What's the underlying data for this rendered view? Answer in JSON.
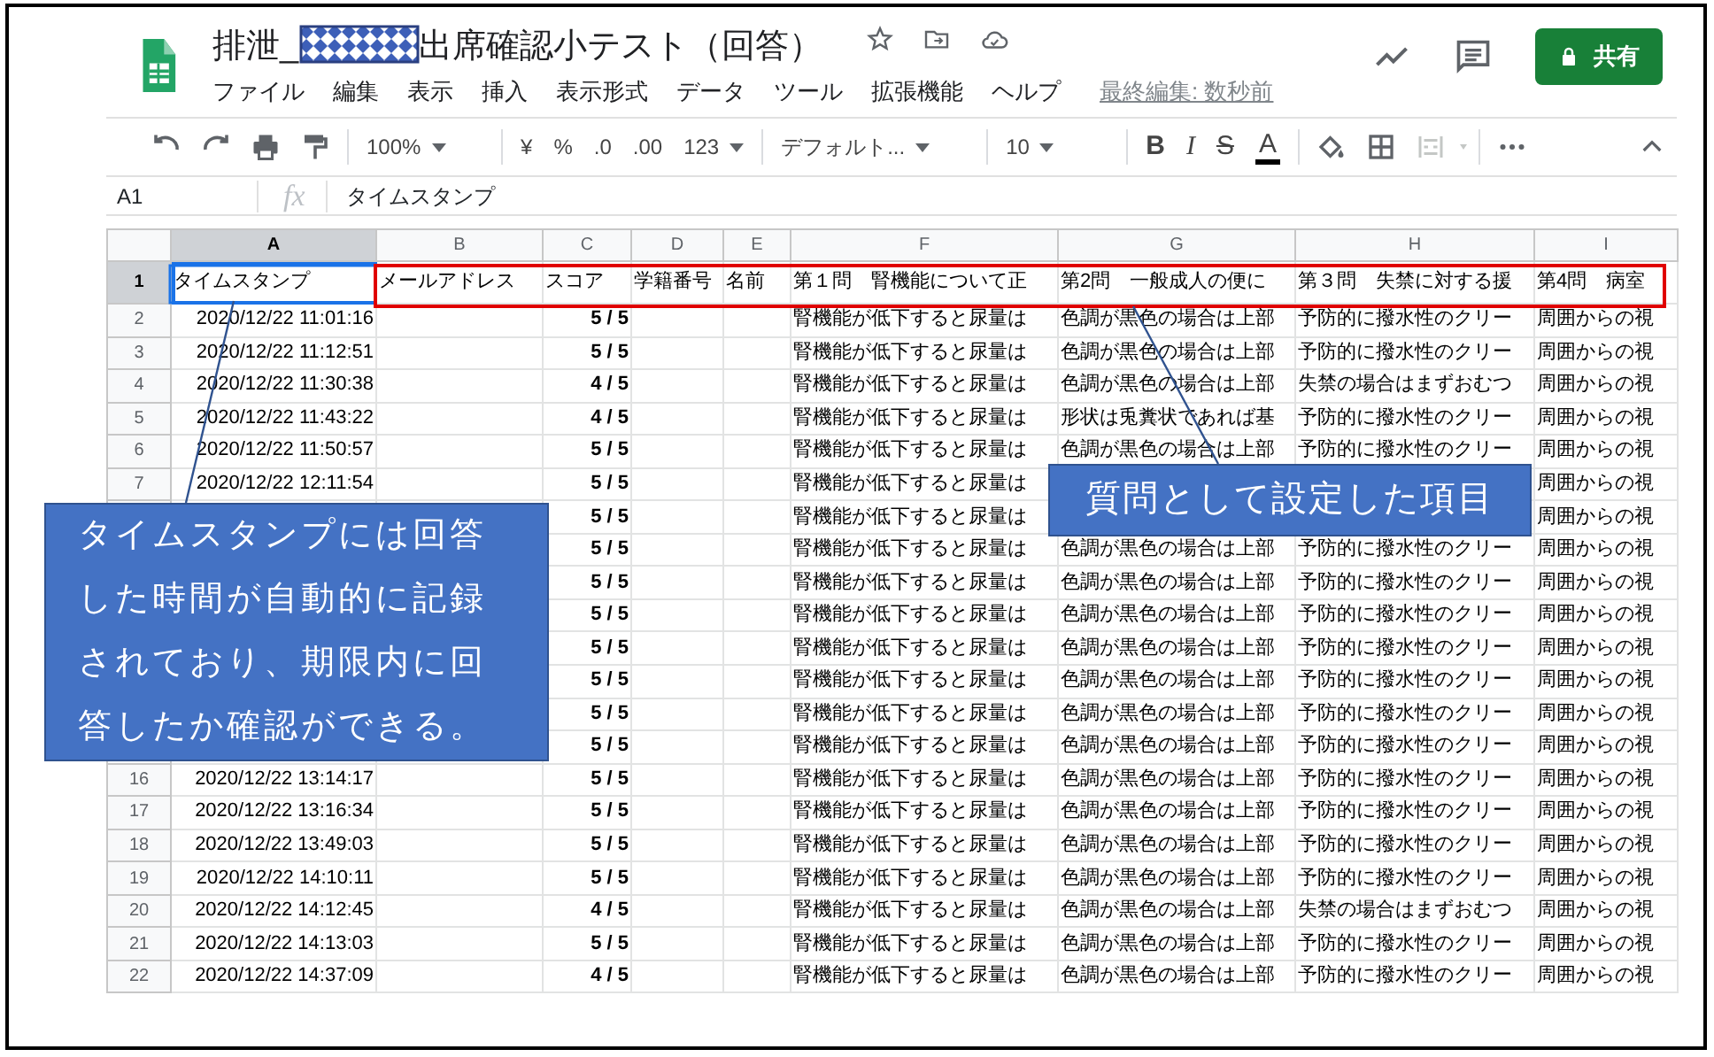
{
  "header": {
    "title_start": "排泄_",
    "title_end": "出席確認小テスト（回答）",
    "menus": [
      "ファイル",
      "編集",
      "表示",
      "挿入",
      "表示形式",
      "データ",
      "ツール",
      "拡張機能",
      "ヘルプ"
    ],
    "last_edit": "最終編集: 数秒前",
    "share": "共有"
  },
  "toolbar": {
    "zoom": "100%",
    "currency": "¥",
    "percent": "%",
    "dec_less": ".0",
    "dec_more": ".00",
    "format": "123",
    "font": "デフォルト...",
    "size": "10",
    "bold": "B",
    "italic": "I",
    "strike": "S",
    "text_color_label": "A"
  },
  "formula_bar": {
    "cell_ref": "A1",
    "fx": "fx",
    "value": "タイムスタンプ"
  },
  "columns": [
    {
      "letter": "A",
      "selected": true
    },
    {
      "letter": "B",
      "selected": false
    },
    {
      "letter": "C",
      "selected": false
    },
    {
      "letter": "D",
      "selected": false
    },
    {
      "letter": "E",
      "selected": false
    },
    {
      "letter": "F",
      "selected": false
    },
    {
      "letter": "G",
      "selected": false
    },
    {
      "letter": "H",
      "selected": false
    },
    {
      "letter": "I",
      "selected": false
    }
  ],
  "rows": [
    {
      "number": "1",
      "selected": true,
      "cells": [
        "タイムスタンプ",
        "メールアドレス",
        "スコア",
        "学籍番号",
        "名前",
        "第１問　腎機能について正",
        "第2問　一般成人の便に",
        "第３問　失禁に対する援",
        "第4問　病室"
      ]
    },
    {
      "number": "2",
      "selected": false,
      "cells": [
        "2020/12/22 11:01:16",
        "",
        "5 / 5",
        "",
        "",
        "腎機能が低下すると尿量は",
        "色調が黒色の場合は上部",
        "予防的に撥水性のクリー",
        "周囲からの視"
      ]
    },
    {
      "number": "3",
      "selected": false,
      "cells": [
        "2020/12/22 11:12:51",
        "",
        "5 / 5",
        "",
        "",
        "腎機能が低下すると尿量は",
        "色調が黒色の場合は上部",
        "予防的に撥水性のクリー",
        "周囲からの視"
      ]
    },
    {
      "number": "4",
      "selected": false,
      "cells": [
        "2020/12/22 11:30:38",
        "",
        "4 / 5",
        "",
        "",
        "腎機能が低下すると尿量は",
        "色調が黒色の場合は上部",
        "失禁の場合はまずおむつ",
        "周囲からの視"
      ]
    },
    {
      "number": "5",
      "selected": false,
      "cells": [
        "2020/12/22 11:43:22",
        "",
        "4 / 5",
        "",
        "",
        "腎機能が低下すると尿量は",
        "形状は兎糞状であれば基",
        "予防的に撥水性のクリー",
        "周囲からの視"
      ]
    },
    {
      "number": "6",
      "selected": false,
      "cells": [
        "2020/12/22 11:50:57",
        "",
        "5 / 5",
        "",
        "",
        "腎機能が低下すると尿量は",
        "色調が黒色の場合は上部",
        "予防的に撥水性のクリー",
        "周囲からの視"
      ]
    },
    {
      "number": "7",
      "selected": false,
      "cells": [
        "2020/12/22 12:11:54",
        "",
        "5 / 5",
        "",
        "",
        "腎機能が低下すると尿量は",
        "",
        "",
        "周囲からの視"
      ]
    },
    {
      "number": "",
      "selected": false,
      "cells": [
        "",
        "",
        "5 / 5",
        "",
        "",
        "腎機能が低下すると尿量は",
        "",
        "",
        "周囲からの視"
      ]
    },
    {
      "number": "",
      "selected": false,
      "cells": [
        "",
        "",
        "5 / 5",
        "",
        "",
        "腎機能が低下すると尿量は",
        "色調が黒色の場合は上部",
        "予防的に撥水性のクリー",
        "周囲からの視"
      ]
    },
    {
      "number": "",
      "selected": false,
      "cells": [
        "",
        "",
        "5 / 5",
        "",
        "",
        "腎機能が低下すると尿量は",
        "色調が黒色の場合は上部",
        "予防的に撥水性のクリー",
        "周囲からの視"
      ]
    },
    {
      "number": "",
      "selected": false,
      "cells": [
        "",
        "",
        "5 / 5",
        "",
        "",
        "腎機能が低下すると尿量は",
        "色調が黒色の場合は上部",
        "予防的に撥水性のクリー",
        "周囲からの視"
      ]
    },
    {
      "number": "",
      "selected": false,
      "cells": [
        "",
        "",
        "5 / 5",
        "",
        "",
        "腎機能が低下すると尿量は",
        "色調が黒色の場合は上部",
        "予防的に撥水性のクリー",
        "周囲からの視"
      ]
    },
    {
      "number": "",
      "selected": false,
      "cells": [
        "",
        "",
        "5 / 5",
        "",
        "",
        "腎機能が低下すると尿量は",
        "色調が黒色の場合は上部",
        "予防的に撥水性のクリー",
        "周囲からの視"
      ]
    },
    {
      "number": "",
      "selected": false,
      "cells": [
        "",
        "",
        "5 / 5",
        "",
        "",
        "腎機能が低下すると尿量は",
        "色調が黒色の場合は上部",
        "予防的に撥水性のクリー",
        "周囲からの視"
      ]
    },
    {
      "number": "",
      "selected": false,
      "cells": [
        "",
        "",
        "5 / 5",
        "",
        "",
        "腎機能が低下すると尿量は",
        "色調が黒色の場合は上部",
        "予防的に撥水性のクリー",
        "周囲からの視"
      ]
    },
    {
      "number": "16",
      "selected": false,
      "cells": [
        "2020/12/22 13:14:17",
        "",
        "5 / 5",
        "",
        "",
        "腎機能が低下すると尿量は",
        "色調が黒色の場合は上部",
        "予防的に撥水性のクリー",
        "周囲からの視"
      ]
    },
    {
      "number": "17",
      "selected": false,
      "cells": [
        "2020/12/22 13:16:34",
        "",
        "5 / 5",
        "",
        "",
        "腎機能が低下すると尿量は",
        "色調が黒色の場合は上部",
        "予防的に撥水性のクリー",
        "周囲からの視"
      ]
    },
    {
      "number": "18",
      "selected": false,
      "cells": [
        "2020/12/22 13:49:03",
        "",
        "5 / 5",
        "",
        "",
        "腎機能が低下すると尿量は",
        "色調が黒色の場合は上部",
        "予防的に撥水性のクリー",
        "周囲からの視"
      ]
    },
    {
      "number": "19",
      "selected": false,
      "cells": [
        "2020/12/22 14:10:11",
        "",
        "5 / 5",
        "",
        "",
        "腎機能が低下すると尿量は",
        "色調が黒色の場合は上部",
        "予防的に撥水性のクリー",
        "周囲からの視"
      ]
    },
    {
      "number": "20",
      "selected": false,
      "cells": [
        "2020/12/22 14:12:45",
        "",
        "4 / 5",
        "",
        "",
        "腎機能が低下すると尿量は",
        "色調が黒色の場合は上部",
        "失禁の場合はまずおむつ",
        "周囲からの視"
      ]
    },
    {
      "number": "21",
      "selected": false,
      "cells": [
        "2020/12/22 14:13:03",
        "",
        "5 / 5",
        "",
        "",
        "腎機能が低下すると尿量は",
        "色調が黒色の場合は上部",
        "予防的に撥水性のクリー",
        "周囲からの視"
      ]
    },
    {
      "number": "22",
      "selected": false,
      "cells": [
        "2020/12/22 14:37:09",
        "",
        "4 / 5",
        "",
        "",
        "腎機能が低下すると尿量は",
        "色調が黒色の場合は上部",
        "予防的に撥水性のクリー",
        "周囲からの視"
      ]
    }
  ],
  "callouts": [
    {
      "lines": [
        "タイムスタンプには回答",
        "した時間が自動的に記録",
        "されており、期限内に回",
        "答したか確認ができる。"
      ]
    },
    {
      "lines": [
        "質問として設定した項目"
      ]
    }
  ]
}
